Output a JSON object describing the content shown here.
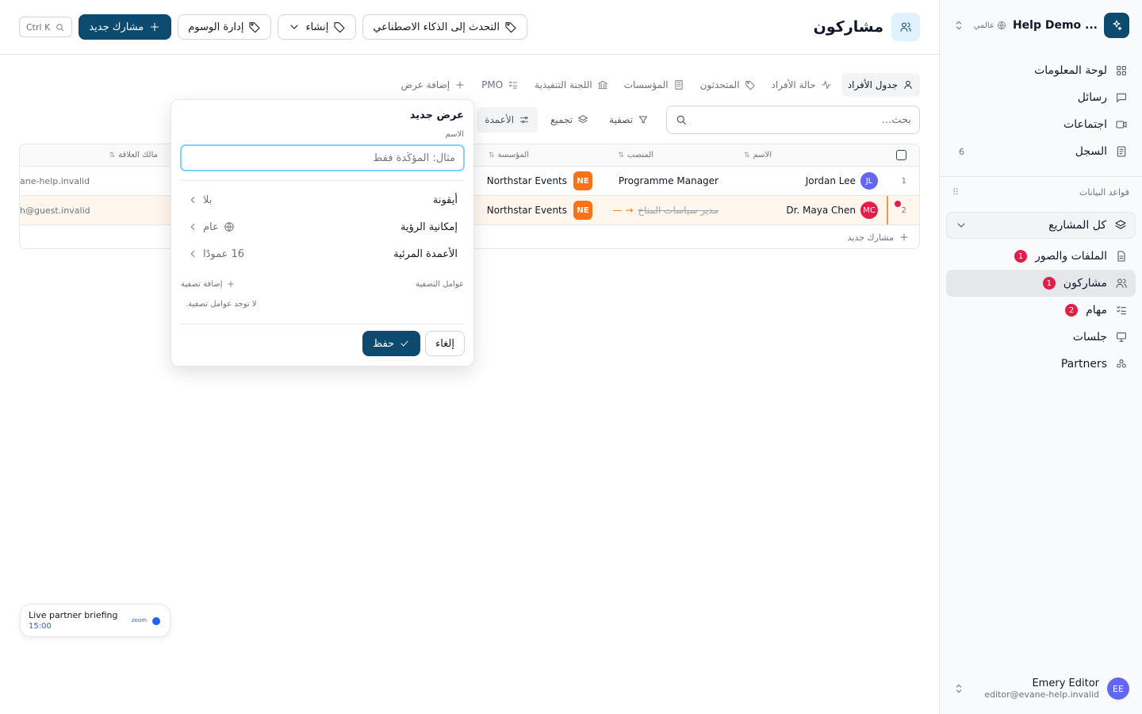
{
  "workspace": {
    "name": "Help Demo ...",
    "scope": "عالمي"
  },
  "nav": [
    {
      "label": "لوحة المعلومات",
      "icon": "dashboard-icon"
    },
    {
      "label": "رسائل",
      "icon": "message-icon"
    },
    {
      "label": "اجتماعات",
      "icon": "video-icon"
    },
    {
      "label": "السجل",
      "icon": "log-icon",
      "count": "6"
    }
  ],
  "databases": {
    "label": "قواعد البيانات",
    "project": "كل المشاريع",
    "items": [
      {
        "label": "الملفات والصور",
        "badge": "1"
      },
      {
        "label": "مشاركون",
        "badge": "1"
      },
      {
        "label": "مهام",
        "badge": "2"
      },
      {
        "label": "جلسات"
      },
      {
        "label": "Partners"
      }
    ]
  },
  "user": {
    "name": "Emery Editor",
    "email": "editor@evane-help.invalid",
    "initials": "EE"
  },
  "header": {
    "title": "مشاركون",
    "shortcut": "Ctrl K",
    "new_participant": "مشارك جديد",
    "manage_tags": "إدارة الوسوم",
    "create": "إنشاء",
    "ai_chat": "التحدث إلى الذكاء الاصطناعي"
  },
  "tabs": [
    "جدول الأفراد",
    "حالة الأفراد",
    "المتحدثون",
    "المؤسسات",
    "اللجنة التنفيذية",
    "PMO",
    "إضافة عرض"
  ],
  "search": {
    "placeholder": "بحث..."
  },
  "filters": {
    "filter": "تصفية",
    "group": "تجميع",
    "columns": "الأعمدة"
  },
  "table": {
    "columns": [
      "الاسم",
      "المنصب",
      "المؤسسة",
      "مالك العلاقة"
    ],
    "rows": [
      {
        "num": "1",
        "initials": "JL",
        "name": "Jordan Lee",
        "role": "Programme Manager",
        "org_initials": "NE",
        "org": "Northstar Events",
        "owner": "ane-help.invalid"
      },
      {
        "num": "2",
        "initials": "MC",
        "name": "Dr. Maya Chen",
        "role_old": "مدير سياسات المناخ",
        "role_arrow": "→ —",
        "org_initials": "NE",
        "org": "Northstar Events",
        "owner": "h@guest.invalid"
      }
    ],
    "add_row": "مشارك جديد"
  },
  "popover": {
    "title": "عرض جديد",
    "name_label": "الاسم",
    "name_placeholder": "مثال: المؤكّدة فقط",
    "icon_label": "أيقونة",
    "icon_value": "بلا",
    "visibility_label": "إمكانية الرؤية",
    "visibility_value": "عام",
    "columns_label": "الأعمدة المرئية",
    "columns_value": "16 عمودًا",
    "filters_label": "عوامل التصفية",
    "add_filter": "إضافة تصفية",
    "no_filters": "لا توجد عوامل تصفية.",
    "cancel": "إلغاء",
    "save": "حفظ"
  },
  "meeting": {
    "title": "Live partner briefing",
    "time": "15:00",
    "provider": "zoom"
  },
  "colors": {
    "accent": "#0c4a6e",
    "danger": "#e11d48",
    "org": "#f97316",
    "avatar_jl": "#6366f1",
    "avatar_mc": "#e11d48"
  }
}
